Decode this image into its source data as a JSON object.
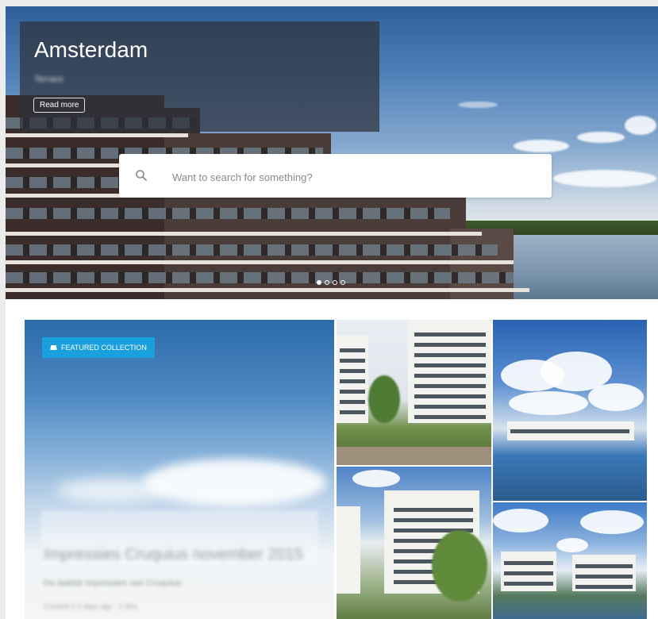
{
  "hero": {
    "title": "Amsterdam",
    "subtitle": "Terrace",
    "read_more_label": "Read more",
    "slide_count": 4,
    "active_slide": 1
  },
  "search": {
    "placeholder": "Want to search for something?",
    "icon": "search-icon"
  },
  "featured": {
    "badge_label": "FEATURED COLLECTION",
    "badge_icon": "sofa-icon",
    "badge_color": "#1aa0dd",
    "title": "Impressies Cruquius november 2015",
    "description": "De laatste impressies van Cruquius.",
    "meta": "Created 1-2 days ago · 1 files"
  },
  "thumbnails": [
    {
      "name": "courtyard-render"
    },
    {
      "name": "waterfront-sky"
    },
    {
      "name": "apartment-garden"
    },
    {
      "name": "harbor-view"
    }
  ]
}
